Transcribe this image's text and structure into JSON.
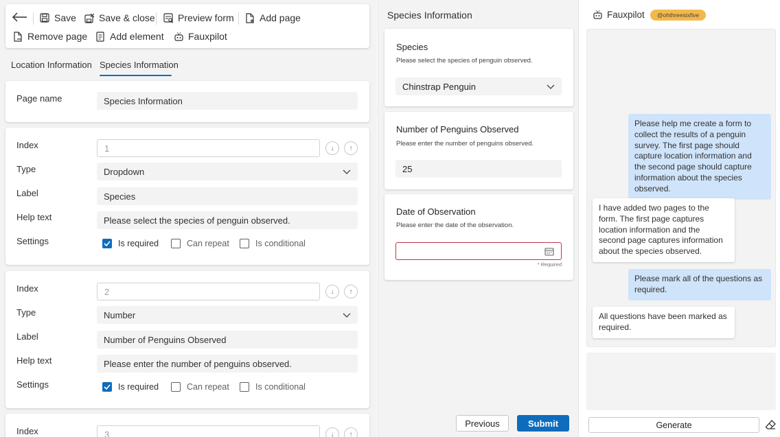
{
  "toolbar": {
    "save": "Save",
    "save_close": "Save & close",
    "preview": "Preview form",
    "add_page": "Add page",
    "remove_page": "Remove page",
    "add_element": "Add element",
    "fauxpilot": "Fauxpilot"
  },
  "tabs": [
    "Location Information",
    "Species Information"
  ],
  "page_settings": {
    "label": "Page name",
    "value": "Species Information"
  },
  "labels": {
    "index": "Index",
    "type": "Type",
    "label": "Label",
    "help_text": "Help text",
    "settings": "Settings",
    "is_required": "Is required",
    "can_repeat": "Can repeat",
    "is_conditional": "Is conditional"
  },
  "elements": [
    {
      "index": "1",
      "type": "Dropdown",
      "label": "Species",
      "help": "Please select the species of penguin observed.",
      "is_required": true,
      "can_repeat": false,
      "is_conditional": false
    },
    {
      "index": "2",
      "type": "Number",
      "label": "Number of Penguins Observed",
      "help": "Please enter the number of penguins observed.",
      "is_required": true,
      "can_repeat": false,
      "is_conditional": false
    },
    {
      "index": "3"
    }
  ],
  "preview": {
    "title": "Species Information",
    "questions": [
      {
        "title": "Species",
        "help": "Please select the species of penguin observed.",
        "value": "Chinstrap Penguin"
      },
      {
        "title": "Number of Penguins Observed",
        "help": "Please enter the number of penguins observed.",
        "value": "25"
      },
      {
        "title": "Date of Observation",
        "help": "Please enter the date of the observation.",
        "value": "",
        "required_note": "* Required"
      }
    ],
    "previous": "Previous",
    "submit": "Submit"
  },
  "chat": {
    "title": "Fauxpilot",
    "user": "@ohthreesixfive",
    "messages": [
      {
        "role": "user",
        "text": "Please help me create a form to collect the results of a penguin survey. The first page should capture location information and the second page should capture information about the species observed."
      },
      {
        "role": "bot",
        "text": "I have added two pages to the form. The first page captures location information and the second page captures information about the species observed."
      },
      {
        "role": "user",
        "text": "Please mark all of the questions as required."
      },
      {
        "role": "bot",
        "text": "All questions have been marked as required."
      }
    ],
    "generate": "Generate"
  },
  "colors": {
    "accent": "#0f6cbd",
    "user_bubble": "#cfe4fa",
    "badge": "#f2b84b",
    "error_border": "#c4314b"
  }
}
